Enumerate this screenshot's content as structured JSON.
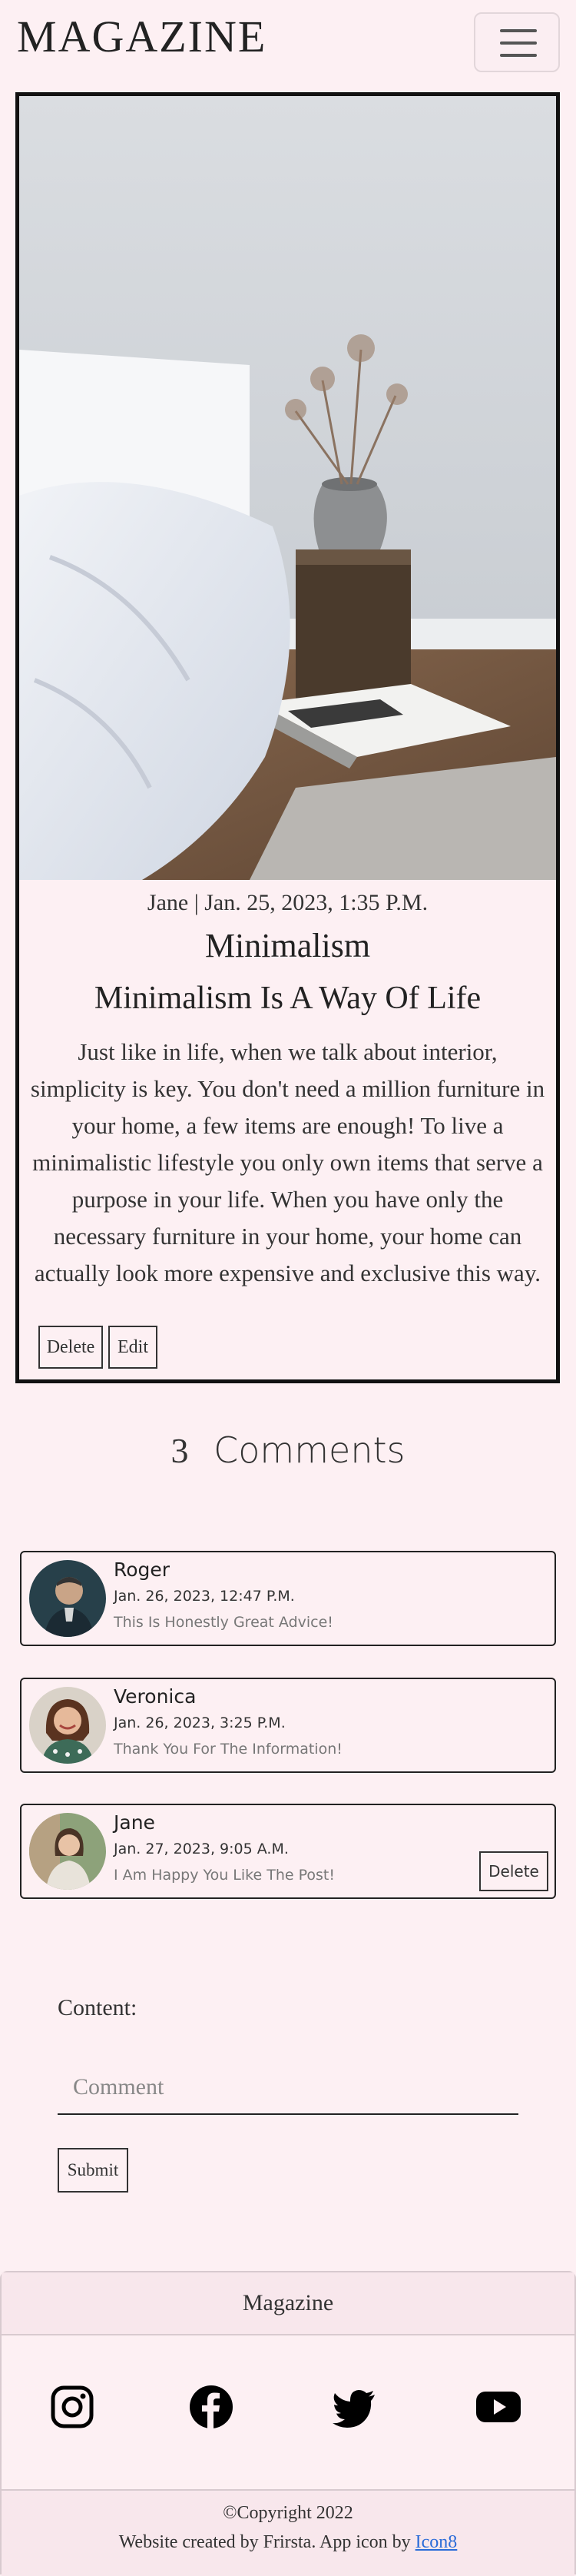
{
  "header": {
    "brand": "MAGAZINE"
  },
  "post": {
    "meta": "Jane | Jan. 25, 2023, 1:35 P.M.",
    "title": "Minimalism",
    "subtitle": "Minimalism Is A Way Of Life",
    "body": "Just like in life, when we talk about interior, simplicity is key. You don't need a million furniture in your home, a few items are enough! To live a minimalistic lifestyle you only own items that serve a purpose in your life. When you have only the necessary furniture in your home, your home can actually look more expensive and exclusive this way.",
    "delete_label": "Delete",
    "edit_label": "Edit"
  },
  "comments_section": {
    "count": "3",
    "heading": "Comments",
    "items": [
      {
        "name": "Roger",
        "date": "Jan. 26, 2023, 12:47 P.M.",
        "text": "This Is Honestly Great Advice!"
      },
      {
        "name": "Veronica",
        "date": "Jan. 26, 2023, 3:25 P.M.",
        "text": "Thank You For The Information!"
      },
      {
        "name": "Jane",
        "date": "Jan. 27, 2023, 9:05 A.M.",
        "text": "I Am Happy You Like The Post!",
        "delete_label": "Delete"
      }
    ]
  },
  "form": {
    "label": "Content:",
    "placeholder": "Comment",
    "value": "",
    "submit_label": "Submit"
  },
  "footer": {
    "title": "Magazine",
    "social_icons": [
      "instagram-icon",
      "facebook-icon",
      "twitter-icon",
      "youtube-icon"
    ],
    "copyright": "©Copyright 2022",
    "credit_text": "Website created by Frirsta. App icon by ",
    "credit_link": "Icon8"
  },
  "colors": {
    "background": "#fdf0f3",
    "footer_band": "#f8e7ec",
    "link": "#2a6bd8",
    "border": "#111111"
  }
}
